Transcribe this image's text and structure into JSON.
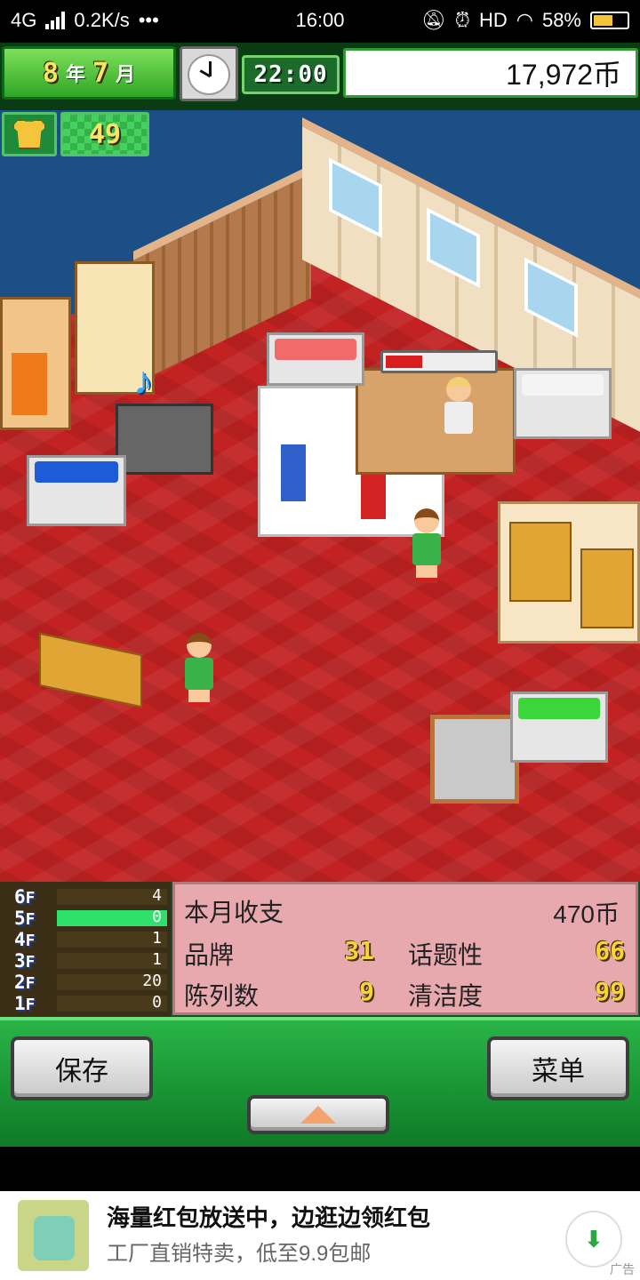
{
  "status_bar": {
    "network": "4G",
    "speed": "0.2K/s",
    "dots": "•••",
    "time": "16:00",
    "hd": "HD",
    "battery": "58%",
    "battery_level": 0.58
  },
  "hud": {
    "year_value": "8",
    "year_unit": "年",
    "month_value": "7",
    "month_unit": "月",
    "time": "22:00",
    "money": "17,972币"
  },
  "game": {
    "shirt_icon": "shirt-icon",
    "customer_count": "49",
    "music_icon": "♪",
    "progress_level": 0.34
  },
  "floors": [
    {
      "label": "6",
      "suffix": "F",
      "value": "4",
      "active": false
    },
    {
      "label": "5",
      "suffix": "F",
      "value": "0",
      "active": true
    },
    {
      "label": "4",
      "suffix": "F",
      "value": "1",
      "active": false
    },
    {
      "label": "3",
      "suffix": "F",
      "value": "1",
      "active": false
    },
    {
      "label": "2",
      "suffix": "F",
      "value": "20",
      "active": false
    },
    {
      "label": "1",
      "suffix": "F",
      "value": "0",
      "active": false
    }
  ],
  "stats": {
    "monthly_label": "本月收支",
    "monthly_value": "470币",
    "brand_label": "品牌",
    "brand_value": "31",
    "topic_label": "话题性",
    "topic_value": "66",
    "display_label": "陈列数",
    "display_value": "9",
    "clean_label": "清洁度",
    "clean_value": "99"
  },
  "buttons": {
    "save": "保存",
    "menu": "菜单"
  },
  "ad": {
    "title": "海量红包放送中，边逛边领红包",
    "subtitle": "工厂直销特卖，低至9.9包邮",
    "tag": "广告"
  },
  "colors": {
    "hud_green": "#2fa626",
    "floor_red": "#c22222",
    "stats_pink": "#e8a9ae",
    "button_bar_green": "#1f9a37",
    "active_floor": "#2fe06a"
  }
}
